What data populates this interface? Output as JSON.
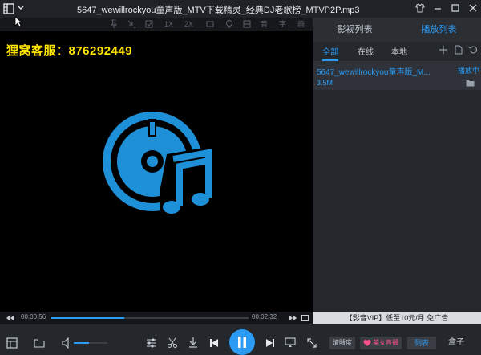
{
  "window": {
    "title": "5647_wewillrockyou童声版_MTV下载精灵_经典DJ老歌榜_MTVP2P.mp3"
  },
  "toolbar": {
    "speed_1x": "1X",
    "speed_2x": "2X",
    "audio_label": "音",
    "subtitle_label": "字",
    "picture_label": "画"
  },
  "video": {
    "watermark": "狸窝客服：876292449"
  },
  "panel": {
    "tabs": [
      {
        "label": "影视列表"
      },
      {
        "label": "播放列表"
      }
    ],
    "subtabs": [
      {
        "label": "全部"
      },
      {
        "label": "在线"
      },
      {
        "label": "本地"
      }
    ],
    "playlist": [
      {
        "name": "5647_wewillrockyou童声版_M...",
        "state": "播放中",
        "size": "3.5M"
      }
    ]
  },
  "playback": {
    "current_time": "00:00:56",
    "total_time": "00:02:32",
    "progress_fraction": 0.368,
    "volume_fraction": 0.45
  },
  "ad": {
    "text": "【影音VIP】低至10元/月 免广告"
  },
  "controls": {
    "clarity_label": "清晰度",
    "live_label": "美女直播",
    "list_label": "列表",
    "box_label": "盒子"
  },
  "colors": {
    "accent": "#2b9bf4",
    "watermark": "#ffe400",
    "live": "#ff4f8a"
  }
}
